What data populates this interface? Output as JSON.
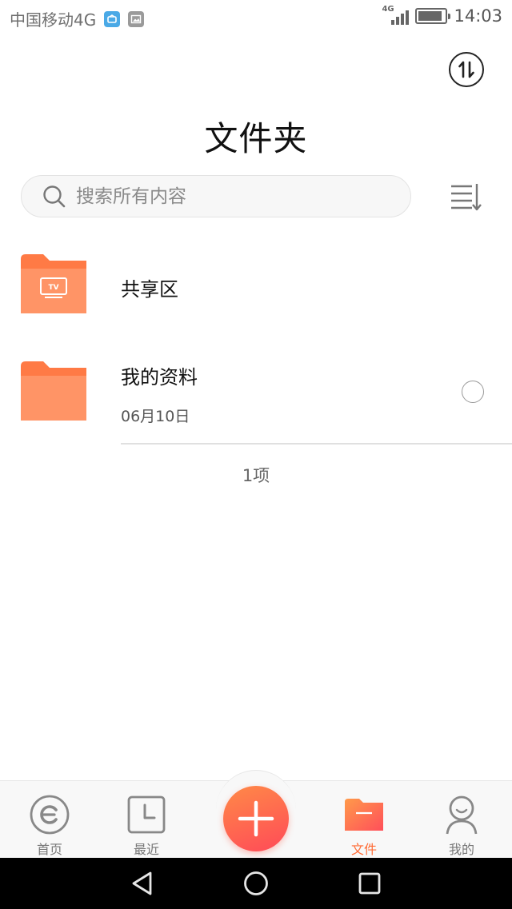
{
  "status_bar": {
    "carrier": "中国移动4G",
    "network_label": "4G",
    "time": "14:03",
    "battery_level": 0.88,
    "icons": [
      "app-notification-icon",
      "image-notification-icon",
      "signal-icon",
      "battery-icon"
    ]
  },
  "header": {
    "title": "文件夹",
    "transfer_icon": "transfer-icon"
  },
  "search": {
    "placeholder": "搜索所有内容",
    "icon": "search-icon"
  },
  "sort_icon": "sort-icon",
  "folders": [
    {
      "name": "共享区",
      "date": "",
      "icon": "shared-tv-folder-icon",
      "selectable": false
    },
    {
      "name": "我的资料",
      "date": "06月10日",
      "icon": "folder-icon",
      "selectable": true
    }
  ],
  "count_text": "1项",
  "bottom_nav": {
    "items": [
      {
        "label": "首页",
        "icon": "home-icon",
        "active": false
      },
      {
        "label": "最近",
        "icon": "recent-icon",
        "active": false
      },
      {
        "label": "文件",
        "icon": "files-icon",
        "active": true
      },
      {
        "label": "我的",
        "icon": "profile-icon",
        "active": false
      }
    ],
    "fab_icon": "plus-icon"
  },
  "colors": {
    "accent": "#ff6a34",
    "folder": "#ff9466",
    "folder_tab": "#ff7a45"
  },
  "system_nav": {
    "icons": [
      "back-icon",
      "home-circle-icon",
      "recents-square-icon"
    ]
  }
}
